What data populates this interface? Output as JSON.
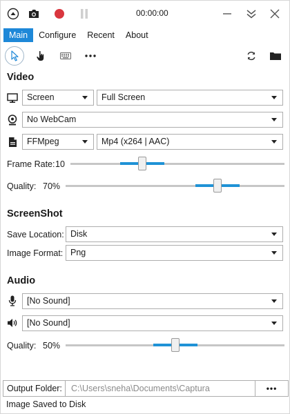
{
  "titlebar": {
    "timer": "00:00:00"
  },
  "tabs": [
    {
      "label": "Main",
      "active": true
    },
    {
      "label": "Configure",
      "active": false
    },
    {
      "label": "Recent",
      "active": false
    },
    {
      "label": "About",
      "active": false
    }
  ],
  "video": {
    "title": "Video",
    "source": "Screen",
    "region": "Full Screen",
    "webcam": "No WebCam",
    "encoder": "FFMpeg",
    "format": "Mp4 (x264 | AAC)",
    "frame_rate_label": "Frame Rate:",
    "frame_rate_value": "10",
    "quality_label": "Quality:",
    "quality_value": "70%",
    "frame_rate_fraction": 0.33,
    "quality_fraction": 0.7
  },
  "screenshot": {
    "title": "ScreenShot",
    "save_location_label": "Save Location:",
    "save_location": "Disk",
    "image_format_label": "Image Format:",
    "image_format": "Png"
  },
  "audio": {
    "title": "Audio",
    "microphone": "[No Sound]",
    "speaker": "[No Sound]",
    "quality_label": "Quality:",
    "quality_value": "50%",
    "quality_fraction": 0.5
  },
  "output": {
    "label": "Output Folder:",
    "path": "C:\\Users\\sneha\\Documents\\Captura",
    "more": "•••"
  },
  "status": "Image Saved to Disk",
  "colors": {
    "accent": "#1e88d8",
    "record": "#d9363e",
    "pause_disabled": "#cfcfcf"
  }
}
